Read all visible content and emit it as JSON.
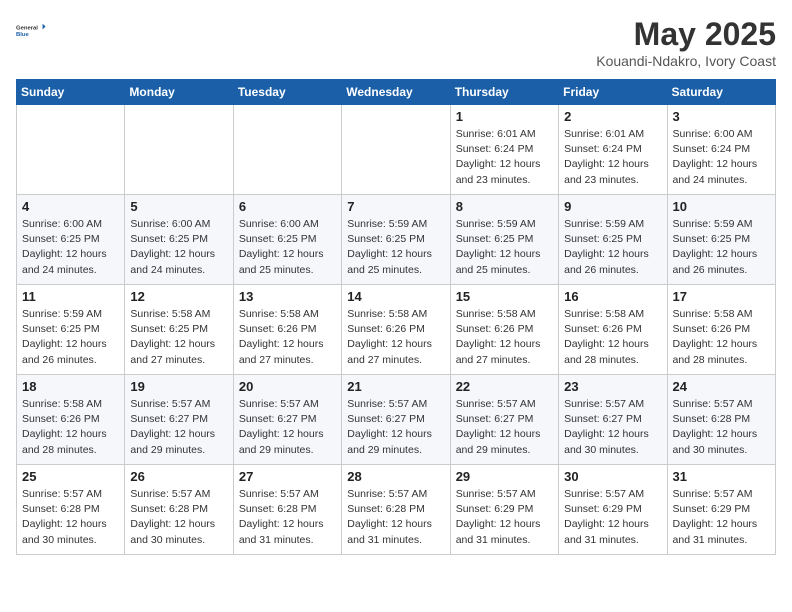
{
  "header": {
    "logo_line1": "General",
    "logo_line2": "Blue",
    "month_year": "May 2025",
    "location": "Kouandi-Ndakro, Ivory Coast"
  },
  "days_of_week": [
    "Sunday",
    "Monday",
    "Tuesday",
    "Wednesday",
    "Thursday",
    "Friday",
    "Saturday"
  ],
  "weeks": [
    [
      {
        "day": "",
        "info": ""
      },
      {
        "day": "",
        "info": ""
      },
      {
        "day": "",
        "info": ""
      },
      {
        "day": "",
        "info": ""
      },
      {
        "day": "1",
        "info": "Sunrise: 6:01 AM\nSunset: 6:24 PM\nDaylight: 12 hours\nand 23 minutes."
      },
      {
        "day": "2",
        "info": "Sunrise: 6:01 AM\nSunset: 6:24 PM\nDaylight: 12 hours\nand 23 minutes."
      },
      {
        "day": "3",
        "info": "Sunrise: 6:00 AM\nSunset: 6:24 PM\nDaylight: 12 hours\nand 24 minutes."
      }
    ],
    [
      {
        "day": "4",
        "info": "Sunrise: 6:00 AM\nSunset: 6:25 PM\nDaylight: 12 hours\nand 24 minutes."
      },
      {
        "day": "5",
        "info": "Sunrise: 6:00 AM\nSunset: 6:25 PM\nDaylight: 12 hours\nand 24 minutes."
      },
      {
        "day": "6",
        "info": "Sunrise: 6:00 AM\nSunset: 6:25 PM\nDaylight: 12 hours\nand 25 minutes."
      },
      {
        "day": "7",
        "info": "Sunrise: 5:59 AM\nSunset: 6:25 PM\nDaylight: 12 hours\nand 25 minutes."
      },
      {
        "day": "8",
        "info": "Sunrise: 5:59 AM\nSunset: 6:25 PM\nDaylight: 12 hours\nand 25 minutes."
      },
      {
        "day": "9",
        "info": "Sunrise: 5:59 AM\nSunset: 6:25 PM\nDaylight: 12 hours\nand 26 minutes."
      },
      {
        "day": "10",
        "info": "Sunrise: 5:59 AM\nSunset: 6:25 PM\nDaylight: 12 hours\nand 26 minutes."
      }
    ],
    [
      {
        "day": "11",
        "info": "Sunrise: 5:59 AM\nSunset: 6:25 PM\nDaylight: 12 hours\nand 26 minutes."
      },
      {
        "day": "12",
        "info": "Sunrise: 5:58 AM\nSunset: 6:25 PM\nDaylight: 12 hours\nand 27 minutes."
      },
      {
        "day": "13",
        "info": "Sunrise: 5:58 AM\nSunset: 6:26 PM\nDaylight: 12 hours\nand 27 minutes."
      },
      {
        "day": "14",
        "info": "Sunrise: 5:58 AM\nSunset: 6:26 PM\nDaylight: 12 hours\nand 27 minutes."
      },
      {
        "day": "15",
        "info": "Sunrise: 5:58 AM\nSunset: 6:26 PM\nDaylight: 12 hours\nand 27 minutes."
      },
      {
        "day": "16",
        "info": "Sunrise: 5:58 AM\nSunset: 6:26 PM\nDaylight: 12 hours\nand 28 minutes."
      },
      {
        "day": "17",
        "info": "Sunrise: 5:58 AM\nSunset: 6:26 PM\nDaylight: 12 hours\nand 28 minutes."
      }
    ],
    [
      {
        "day": "18",
        "info": "Sunrise: 5:58 AM\nSunset: 6:26 PM\nDaylight: 12 hours\nand 28 minutes."
      },
      {
        "day": "19",
        "info": "Sunrise: 5:57 AM\nSunset: 6:27 PM\nDaylight: 12 hours\nand 29 minutes."
      },
      {
        "day": "20",
        "info": "Sunrise: 5:57 AM\nSunset: 6:27 PM\nDaylight: 12 hours\nand 29 minutes."
      },
      {
        "day": "21",
        "info": "Sunrise: 5:57 AM\nSunset: 6:27 PM\nDaylight: 12 hours\nand 29 minutes."
      },
      {
        "day": "22",
        "info": "Sunrise: 5:57 AM\nSunset: 6:27 PM\nDaylight: 12 hours\nand 29 minutes."
      },
      {
        "day": "23",
        "info": "Sunrise: 5:57 AM\nSunset: 6:27 PM\nDaylight: 12 hours\nand 30 minutes."
      },
      {
        "day": "24",
        "info": "Sunrise: 5:57 AM\nSunset: 6:28 PM\nDaylight: 12 hours\nand 30 minutes."
      }
    ],
    [
      {
        "day": "25",
        "info": "Sunrise: 5:57 AM\nSunset: 6:28 PM\nDaylight: 12 hours\nand 30 minutes."
      },
      {
        "day": "26",
        "info": "Sunrise: 5:57 AM\nSunset: 6:28 PM\nDaylight: 12 hours\nand 30 minutes."
      },
      {
        "day": "27",
        "info": "Sunrise: 5:57 AM\nSunset: 6:28 PM\nDaylight: 12 hours\nand 31 minutes."
      },
      {
        "day": "28",
        "info": "Sunrise: 5:57 AM\nSunset: 6:28 PM\nDaylight: 12 hours\nand 31 minutes."
      },
      {
        "day": "29",
        "info": "Sunrise: 5:57 AM\nSunset: 6:29 PM\nDaylight: 12 hours\nand 31 minutes."
      },
      {
        "day": "30",
        "info": "Sunrise: 5:57 AM\nSunset: 6:29 PM\nDaylight: 12 hours\nand 31 minutes."
      },
      {
        "day": "31",
        "info": "Sunrise: 5:57 AM\nSunset: 6:29 PM\nDaylight: 12 hours\nand 31 minutes."
      }
    ]
  ]
}
